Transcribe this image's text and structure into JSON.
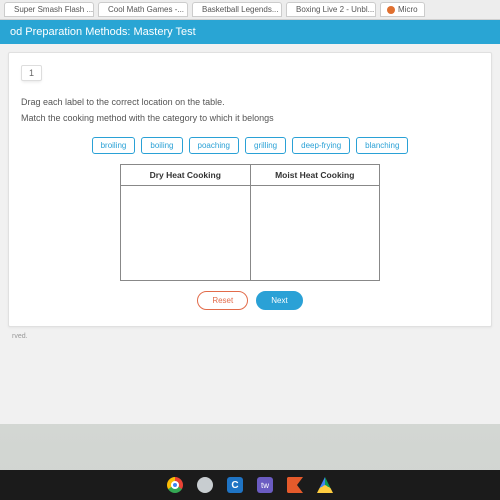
{
  "browser": {
    "tabs": [
      {
        "label": "Super Smash Flash ..."
      },
      {
        "label": "Cool Math Games -..."
      },
      {
        "label": "Basketball Legends..."
      },
      {
        "label": "Boxing Live 2 - Unbl..."
      },
      {
        "label": "Micro"
      }
    ]
  },
  "page": {
    "title": "od Preparation Methods: Mastery Test"
  },
  "question": {
    "number": "1",
    "instruction1": "Drag each label to the correct location on the table.",
    "instruction2": "Match the cooking method with the category to which it belongs"
  },
  "chips": [
    "broiling",
    "boiling",
    "poaching",
    "grilling",
    "deep-frying",
    "blanching"
  ],
  "table": {
    "col1": "Dry Heat Cooking",
    "col2": "Moist Heat Cooking"
  },
  "buttons": {
    "reset": "Reset",
    "next": "Next"
  },
  "footer": "rved."
}
